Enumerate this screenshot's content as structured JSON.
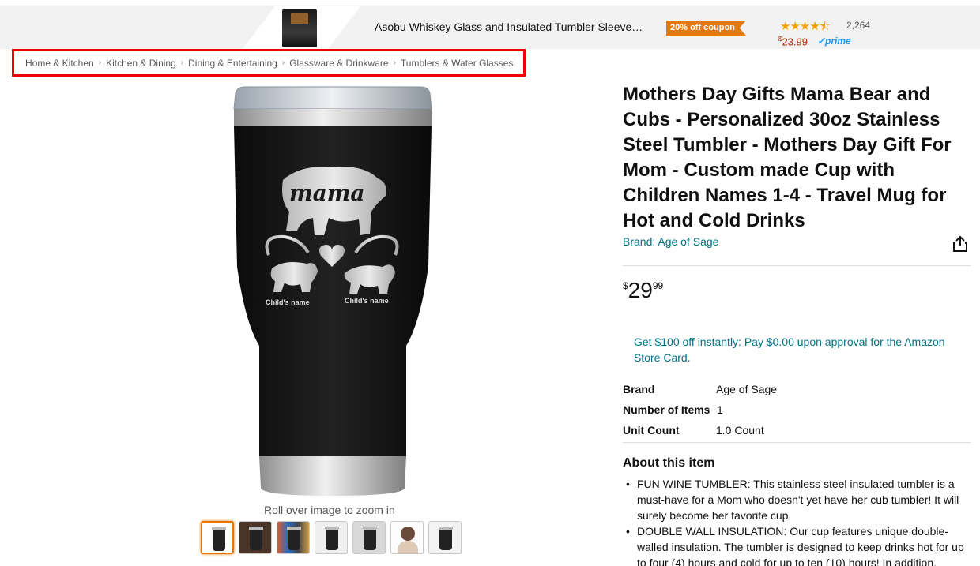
{
  "banner": {
    "title": "Asobu Whiskey Glass and Insulated Tumbler Sleeve…",
    "coupon": "20% off coupon",
    "stars": "★★★★⯪",
    "rating_count": "2,264",
    "price_symbol": "$",
    "price": "23.99",
    "prime": "✓prime"
  },
  "breadcrumb": {
    "items": [
      "Home & Kitchen",
      "Kitchen & Dining",
      "Dining & Entertaining",
      "Glassware & Drinkware",
      "Tumblers & Water Glasses"
    ],
    "separator": "›"
  },
  "gallery": {
    "main_image_text": "mama",
    "child_label_1": "Child's name",
    "child_label_2": "Child's name",
    "zoom_hint": "Roll over image to zoom in",
    "thumbnail_count": 7
  },
  "product": {
    "title": "Mothers Day Gifts Mama Bear and Cubs - Personalized 30oz Stainless Steel Tumbler - Mothers Day Gift For Mom - Custom made Cup with Children Names 1-4 - Travel Mug for Hot and Cold Drinks",
    "brand_link": "Brand: Age of Sage",
    "price_symbol": "$",
    "price_whole": "29",
    "price_fraction": "99",
    "promo": "Get $100 off instantly: Pay $0.00 upon approval for the Amazon Store Card."
  },
  "specs": [
    {
      "label": "Brand",
      "value": "Age of Sage"
    },
    {
      "label": "Number of Items",
      "value": "1"
    },
    {
      "label": "Unit Count",
      "value": "1.0 Count"
    }
  ],
  "about": {
    "title": "About this item",
    "bullets": [
      "FUN WINE TUMBLER: This stainless steel insulated tumbler is a must-have for a Mom who doesn't yet have her cub tumbler! It will surely become her favorite cup.",
      "DOUBLE WALL INSULATION: Our cup features unique double-walled insulation. The tumbler is designed to keep drinks hot for up to four (4) hours and cold for up to ten (10) hours! In addition,"
    ]
  },
  "colors": {
    "link": "#007185",
    "coupon": "#e47911",
    "price_red": "#b12704",
    "star": "#f2a000",
    "highlight_border": "#ee0000"
  }
}
